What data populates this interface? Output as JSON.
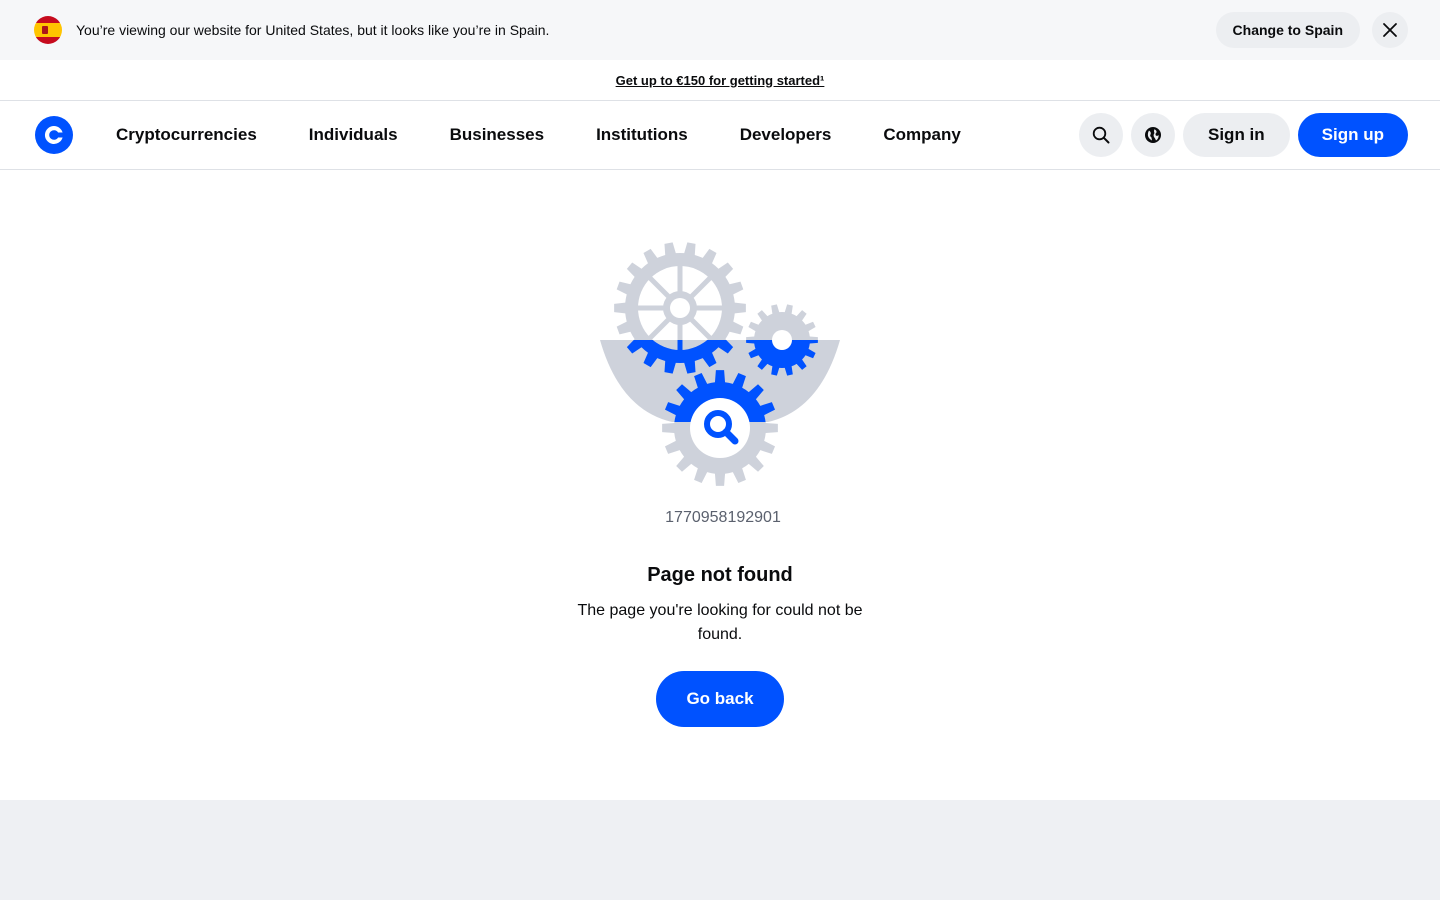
{
  "banner": {
    "flag_icon": "spain-flag-icon",
    "message": "You’re viewing our website for United States, but it looks like you’re in Spain.",
    "change_label": "Change to Spain",
    "close_icon": "close-icon"
  },
  "promo": {
    "link_text": "Get up to €150 for getting started¹"
  },
  "nav": {
    "logo_icon": "coinbase-logo-icon",
    "items": [
      "Cryptocurrencies",
      "Individuals",
      "Businesses",
      "Institutions",
      "Developers",
      "Company"
    ],
    "search_icon": "search-icon",
    "globe_icon": "globe-icon",
    "signin_label": "Sign in",
    "signup_label": "Sign up"
  },
  "main": {
    "illustration_icon": "gears-magnifier-illustration",
    "error_code": "1770958192901",
    "title": "Page not found",
    "description": "The page you're looking for could not be found.",
    "go_back_label": "Go back"
  },
  "colors": {
    "brand_blue": "#0052ff",
    "gear_gray": "#ced2db",
    "banner_bg": "#f6f7f9",
    "footer_bg": "#eef0f3"
  }
}
